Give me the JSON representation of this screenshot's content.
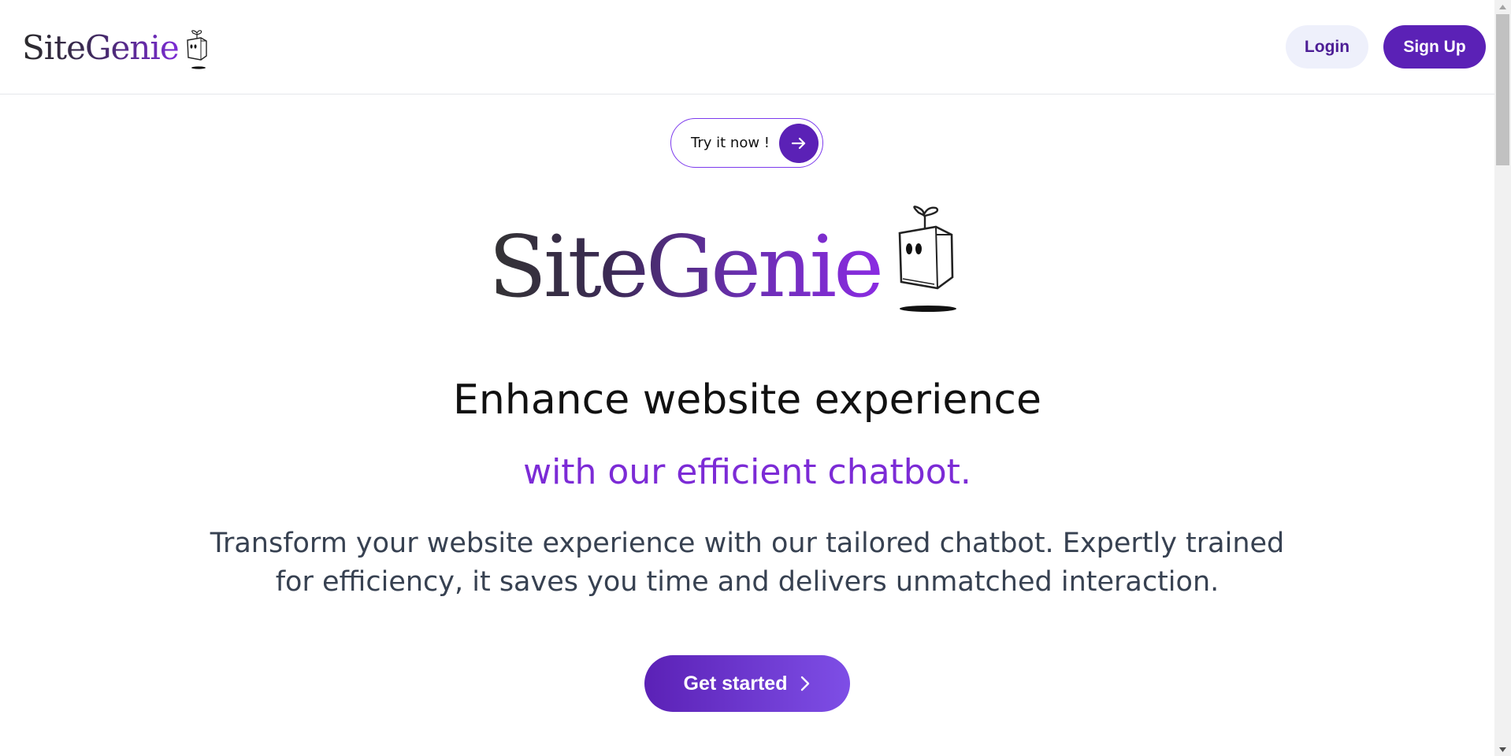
{
  "header": {
    "brand_name": "SiteGenie",
    "login_label": "Login",
    "signup_label": "Sign Up"
  },
  "hero": {
    "try_label": "Try it now !",
    "logo_name": "SiteGenie",
    "headline": "Enhance website experience",
    "subheadline": "with our efficient chatbot.",
    "description": "Transform your website experience with our tailored chatbot. Expertly trained for efficiency, it saves you time and delivers unmatched interaction.",
    "cta_label": "Get started"
  },
  "icons": {
    "try_arrow": "arrow-right-icon",
    "cta_chevron": "chevron-right-icon",
    "mascot": "genie-box-mascot-icon"
  },
  "colors": {
    "brand_purple": "#5b21b6",
    "accent_purple": "#7c2bd6",
    "login_bg": "#eef0fb"
  }
}
